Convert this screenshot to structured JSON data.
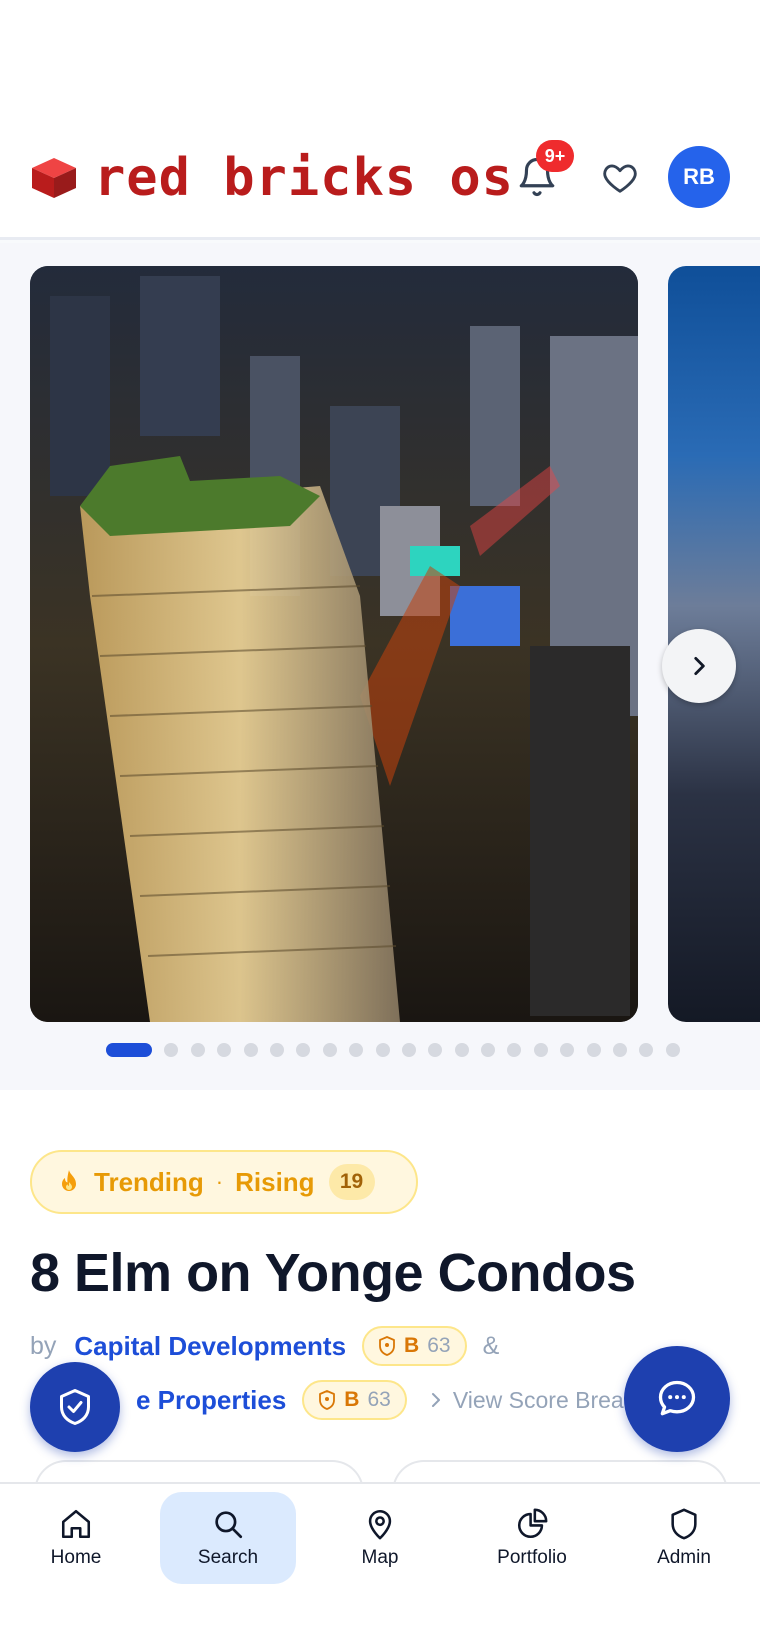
{
  "header": {
    "brand_name": "red bricks os",
    "notifications_badge": "9+",
    "avatar_initials": "RB"
  },
  "carousel": {
    "slide_count": 21,
    "active_index": 0
  },
  "listing": {
    "trend": {
      "label_primary": "Trending",
      "separator": "·",
      "label_secondary": "Rising",
      "count": "19"
    },
    "title": "8 Elm on Yonge Condos",
    "by_label": "by",
    "developer_1": {
      "name": "Capital Developments",
      "grade": "B",
      "score": "63"
    },
    "ampersand": "&",
    "developer_2": {
      "name_visible": "e Properties",
      "grade": "B",
      "score": "63"
    },
    "view_score_label": "View Score Breako"
  },
  "bottom_nav": {
    "items": [
      {
        "label": "Home",
        "icon": "home-icon",
        "active": false
      },
      {
        "label": "Search",
        "icon": "search-icon",
        "active": true
      },
      {
        "label": "Map",
        "icon": "map-pin-icon",
        "active": false
      },
      {
        "label": "Portfolio",
        "icon": "pie-chart-icon",
        "active": false
      },
      {
        "label": "Admin",
        "icon": "shield-icon",
        "active": false
      }
    ]
  },
  "colors": {
    "brand_red": "#b91c1c",
    "primary_blue": "#1d4ed8",
    "fab_blue": "#1e40af",
    "trend_amber": "#e79a06",
    "badge_red": "#ef2b2d"
  }
}
